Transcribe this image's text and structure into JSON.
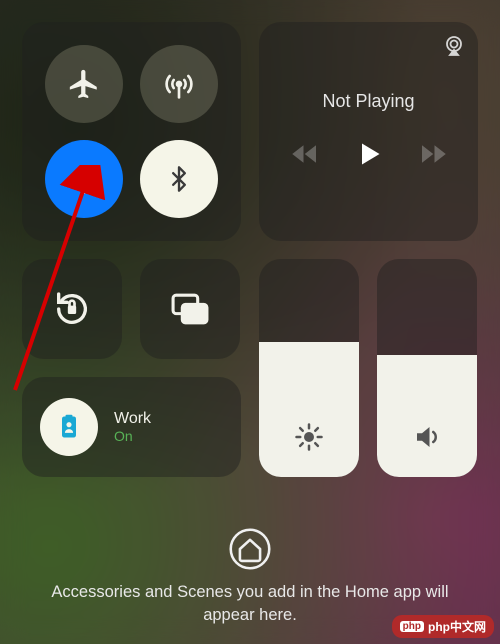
{
  "media": {
    "status": "Not Playing"
  },
  "focus": {
    "title": "Work",
    "subtitle": "On"
  },
  "sliders": {
    "brightness_pct": 62,
    "volume_pct": 56
  },
  "home_message": "Accessories and Scenes you add in the Home app will appear here.",
  "watermark": "php中文网"
}
